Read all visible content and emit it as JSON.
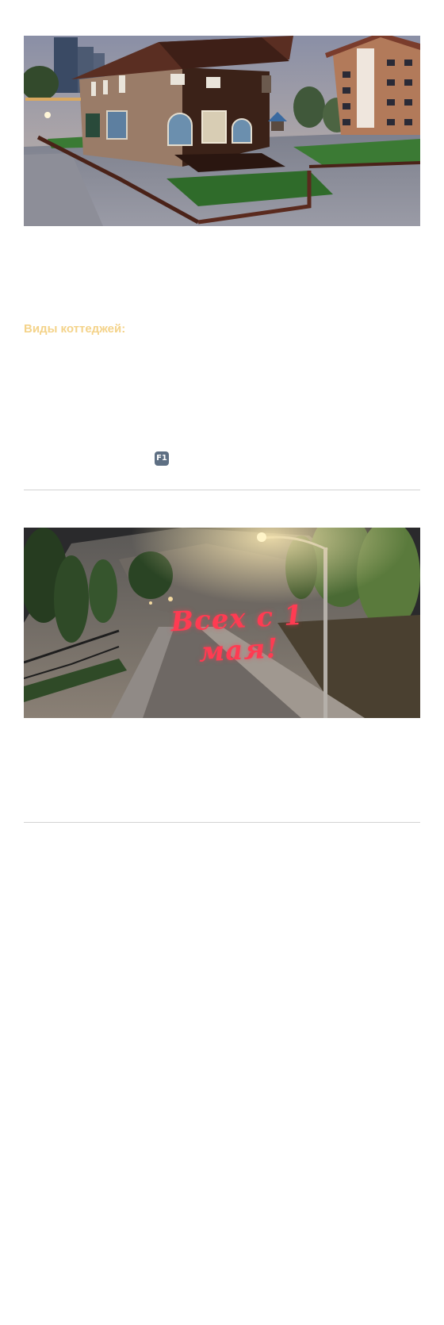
{
  "colors": {
    "accent_heading": "#f4d38a",
    "badge_bg": "#5e6f83",
    "greeting_text": "#ff3b52",
    "divider": "#d3d3d3",
    "faint_text": "#f5f5f5"
  },
  "post1": {
    "image": {
      "icon": "cottage-scene-image"
    },
    "section_heading": "Виды коттеджей:",
    "key_badge": "F1"
  },
  "post2": {
    "image": {
      "icon": "night-road-scene-image",
      "overlay_text": "Всех с 1 мая!"
    }
  }
}
